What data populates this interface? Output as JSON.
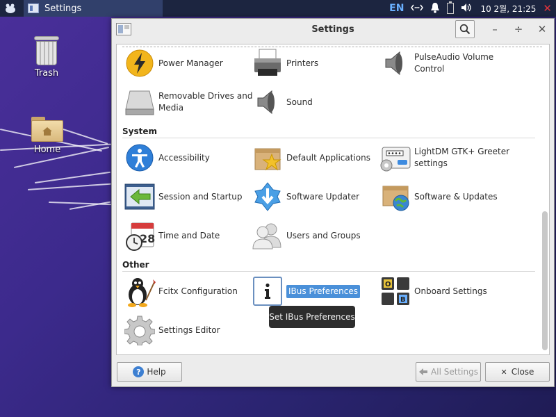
{
  "panel": {
    "task_title": "Settings",
    "keyboard_layout": "EN",
    "clock": "10 2월, 21:25"
  },
  "desktop": {
    "trash_label": "Trash",
    "home_label": "Home"
  },
  "window": {
    "title": "Settings",
    "sections": {
      "top_items": [
        "Power Manager",
        "Printers",
        "PulseAudio Volume Control",
        "Removable Drives and Media",
        "Sound"
      ],
      "system_title": "System",
      "system_items": [
        "Accessibility",
        "Default Applications",
        "LightDM GTK+ Greeter settings",
        "Session and Startup",
        "Software Updater",
        "Software & Updates",
        "Time and Date",
        "Users and Groups"
      ],
      "other_title": "Other",
      "other_items": [
        "Fcitx Configuration",
        "IBus Preferences",
        "Onboard Settings",
        "Settings Editor"
      ]
    },
    "tooltip": "Set IBus Preferences",
    "footer": {
      "help": "Help",
      "all_settings": "All Settings",
      "close": "Close"
    }
  }
}
